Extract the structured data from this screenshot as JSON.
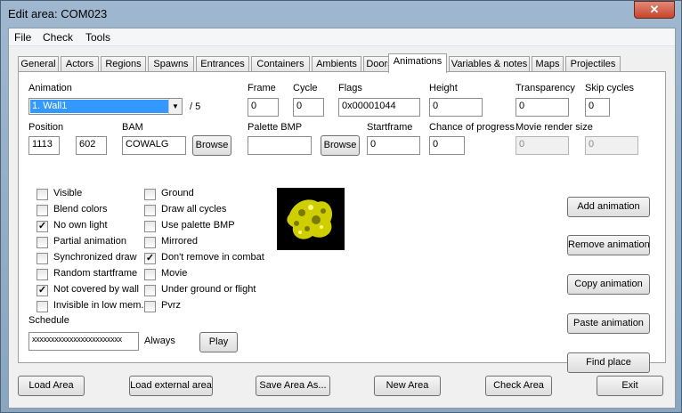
{
  "window": {
    "title": "Edit area: COM023",
    "close": "✕"
  },
  "menu": [
    "File",
    "Check",
    "Tools"
  ],
  "tabs": [
    "General",
    "Actors",
    "Regions",
    "Spawns",
    "Entrances",
    "Containers",
    "Ambients",
    "Doors",
    "Animations",
    "Variables & notes",
    "Maps",
    "Projectiles"
  ],
  "active_tab": "Animations",
  "animation": {
    "label": "Animation",
    "selected": "1. Wall1",
    "count": "/ 5",
    "frame_label": "Frame",
    "frame": "0",
    "cycle_label": "Cycle",
    "cycle": "0",
    "flags_label": "Flags",
    "flags": "0x00001044",
    "height_label": "Height",
    "height": "0",
    "transparency_label": "Transparency",
    "transparency": "0",
    "skip_label": "Skip cycles",
    "skip": "0",
    "position_label": "Position",
    "pos_x": "1113",
    "pos_y": "602",
    "bam_label": "BAM",
    "bam": "COWALG",
    "browse": "Browse",
    "palette_label": "Palette BMP",
    "palette": "",
    "browse2": "Browse",
    "startframe_label": "Startframe",
    "startframe": "0",
    "chance_label": "Chance of progress",
    "chance": "0",
    "movie_label": "Movie render size",
    "movie_w": "0",
    "movie_h": "0"
  },
  "checks_left": [
    {
      "label": "Visible",
      "checked": false
    },
    {
      "label": "Blend colors",
      "checked": false
    },
    {
      "label": "No own light",
      "checked": true
    },
    {
      "label": "Partial animation",
      "checked": false
    },
    {
      "label": "Synchronized draw",
      "checked": false
    },
    {
      "label": "Random startframe",
      "checked": false
    },
    {
      "label": "Not covered by wall",
      "checked": true
    },
    {
      "label": "Invisible in low mem.",
      "checked": false
    }
  ],
  "checks_right": [
    {
      "label": "Ground",
      "checked": false
    },
    {
      "label": "Draw all cycles",
      "checked": false
    },
    {
      "label": "Use palette BMP",
      "checked": false
    },
    {
      "label": "Mirrored",
      "checked": false
    },
    {
      "label": "Don't remove in combat",
      "checked": true
    },
    {
      "label": "Movie",
      "checked": false
    },
    {
      "label": "Under ground or flight",
      "checked": false
    },
    {
      "label": "Pvrz",
      "checked": false
    }
  ],
  "schedule": {
    "label": "Schedule",
    "value": "xxxxxxxxxxxxxxxxxxxxxxxx",
    "always": "Always",
    "play": "Play"
  },
  "side_buttons": [
    "Add animation",
    "Remove animation",
    "Copy animation",
    "Paste animation",
    "Find place"
  ],
  "bottom_buttons": [
    "Load Area",
    "Load external area",
    "Save Area As...",
    "New Area",
    "Check Area",
    "Exit"
  ],
  "colors": {
    "selection": "#3399ff",
    "close": "#c7442c",
    "preview_fg": "#e6e600"
  }
}
